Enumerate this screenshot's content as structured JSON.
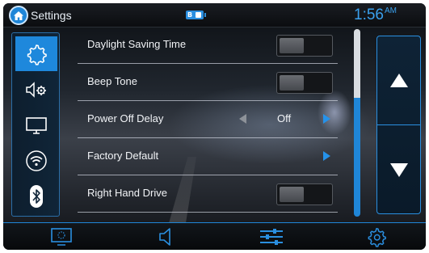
{
  "header": {
    "title": "Settings",
    "home_icon": "home-icon",
    "battery_label": "B",
    "clock_time": "1:56",
    "clock_ampm": "AM"
  },
  "sidebar": {
    "items": [
      {
        "icon": "gear-icon",
        "active": true
      },
      {
        "icon": "speaker-settings-icon",
        "active": false
      },
      {
        "icon": "display-icon",
        "active": false
      },
      {
        "icon": "wifi-icon",
        "active": false
      },
      {
        "icon": "bluetooth-icon",
        "active": false
      }
    ]
  },
  "settings": {
    "rows": [
      {
        "label": "Daylight Saving Time",
        "control": "toggle"
      },
      {
        "label": "Beep Tone",
        "control": "toggle"
      },
      {
        "label": "Power Off Delay",
        "control": "selector",
        "value": "Off"
      },
      {
        "label": "Factory Default",
        "control": "arrow"
      },
      {
        "label": "Right Hand Drive",
        "control": "toggle"
      }
    ]
  },
  "scroll": {
    "position_fraction": 0.37
  },
  "navigation": {
    "up_icon": "arrow-up-icon",
    "down_icon": "arrow-down-icon"
  },
  "bottom_bar": {
    "items": [
      "screen-icon",
      "speaker-icon",
      "equalizer-icon",
      "gear-icon"
    ]
  },
  "colors": {
    "accent": "#1f86d8",
    "clock": "#3aa1ee",
    "toggle_bg": "#141619"
  }
}
